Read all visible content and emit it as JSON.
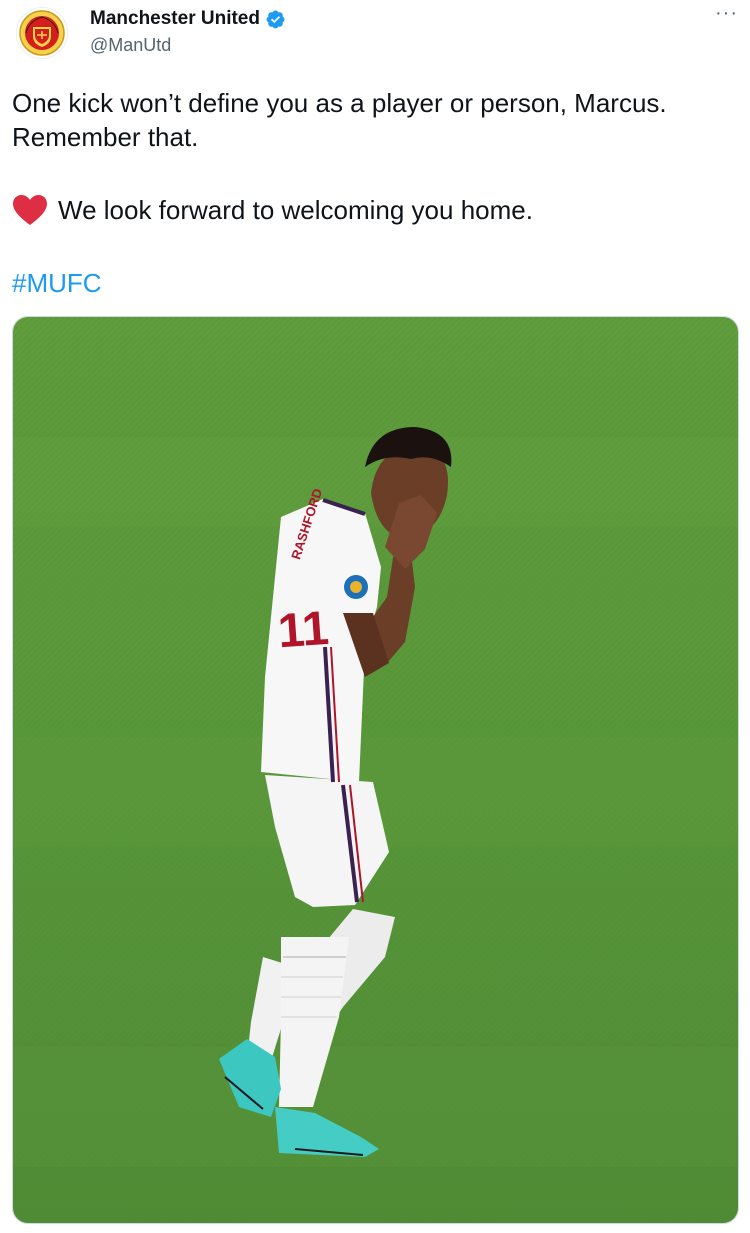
{
  "tweet": {
    "author_name": "Manchester United",
    "author_handle": "@ManUtd",
    "more_glyph": "···",
    "text_line1": "One kick won’t define you as a player or person, Marcus. Remember that.",
    "text_line2": "We look forward to welcoming you home.",
    "hashtag": "#MUFC"
  },
  "icons": {
    "avatar": "manchester-united-crest-icon",
    "verified": "verified-badge-icon",
    "heart": "red-heart-emoji-icon",
    "more": "more-options-icon"
  },
  "colors": {
    "link": "#1d9bf0",
    "verified": "#1d9bf0",
    "heart": "#e0245e",
    "pitch": "#5b9a3a"
  },
  "photo": {
    "shirt_text": "RASHFORD",
    "shirt_number": "11"
  }
}
